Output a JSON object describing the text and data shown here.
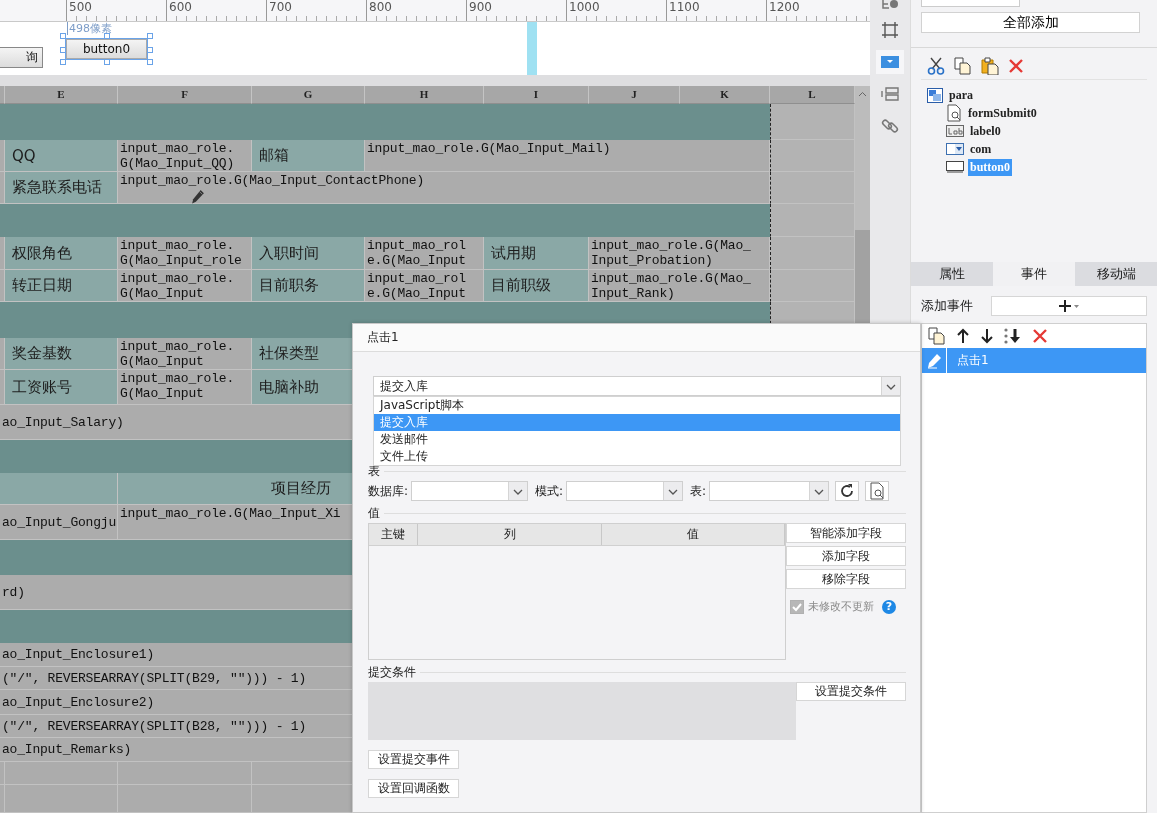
{
  "ruler": {
    "labels": [
      "500",
      "600",
      "700",
      "800",
      "900",
      "1000",
      "1100",
      "1200"
    ]
  },
  "design": {
    "size_hint": "498像素",
    "buttons": [
      {
        "label": "询",
        "selected": false
      },
      {
        "label": "button0",
        "selected": true
      }
    ]
  },
  "sheet": {
    "columns": [
      "E",
      "F",
      "G",
      "H",
      "I",
      "J",
      "K",
      "L"
    ],
    "rows": [
      {
        "kind": "band"
      },
      {
        "kind": "pair",
        "cells": [
          {
            "kind": "edge"
          },
          {
            "kind": "label",
            "text": "QQ"
          },
          {
            "kind": "value",
            "text": "input_mao_role.\nG(Mao_Input_QQ)"
          },
          {
            "kind": "label",
            "text": "邮箱"
          },
          {
            "kind": "value",
            "text": "input_mao_role.G(Mao_Input_Mail)"
          }
        ]
      },
      {
        "kind": "wide",
        "cells": [
          {
            "kind": "edge"
          },
          {
            "kind": "label",
            "text": "紧急联系电话"
          },
          {
            "kind": "value",
            "text": "input_mao_role.G(Mao_Input_ContactPhone)"
          }
        ]
      },
      {
        "kind": "band"
      },
      {
        "kind": "triple",
        "cells": [
          {
            "kind": "edge"
          },
          {
            "kind": "label",
            "text": "权限角色"
          },
          {
            "kind": "value",
            "text": "input_mao_role.\nG(Mao_Input_role"
          },
          {
            "kind": "label",
            "text": "入职时间"
          },
          {
            "kind": "value",
            "text": "input_mao_rol\ne.G(Mao_Input"
          },
          {
            "kind": "label",
            "text": "试用期"
          },
          {
            "kind": "value",
            "text": "input_mao_role.G(Mao_\nInput_Probation)"
          }
        ]
      },
      {
        "kind": "triple",
        "cells": [
          {
            "kind": "edge"
          },
          {
            "kind": "label",
            "text": "转正日期"
          },
          {
            "kind": "value",
            "text": "input_mao_role.\nG(Mao_Input"
          },
          {
            "kind": "label",
            "text": "目前职务"
          },
          {
            "kind": "value",
            "text": "input_mao_rol\ne.G(Mao_Input"
          },
          {
            "kind": "label",
            "text": "目前职级"
          },
          {
            "kind": "value",
            "text": "input_mao_role.G(Mao_\nInput_Rank)"
          }
        ]
      },
      {
        "kind": "band"
      },
      {
        "kind": "pair_cut",
        "cells": [
          {
            "kind": "edge"
          },
          {
            "kind": "label",
            "text": "奖金基数"
          },
          {
            "kind": "value",
            "text": "input_mao_role.\nG(Mao_Input"
          },
          {
            "kind": "label",
            "text": "社保类型"
          }
        ]
      },
      {
        "kind": "pair_cut",
        "cells": [
          {
            "kind": "edge"
          },
          {
            "kind": "label",
            "text": "工资账号"
          },
          {
            "kind": "value",
            "text": "input_mao_role.\nG(Mao_Input"
          },
          {
            "kind": "label",
            "text": "电脑补助"
          }
        ]
      },
      {
        "kind": "full",
        "cells": [
          {
            "kind": "value",
            "text": "ao_Input_Salary)"
          }
        ]
      },
      {
        "kind": "band"
      },
      {
        "kind": "heading",
        "cells": [
          {
            "kind": "label"
          },
          {
            "kind": "caption",
            "text": "项目经历"
          },
          {
            "kind": "label"
          }
        ]
      },
      {
        "kind": "split",
        "cells": [
          {
            "kind": "value",
            "text": "ao_Input_Gongju"
          },
          {
            "kind": "value",
            "text": "input_mao_role.G(Mao_Input_Xi"
          }
        ]
      },
      {
        "kind": "band"
      },
      {
        "kind": "full",
        "cells": [
          {
            "kind": "value",
            "text": "rd)"
          }
        ]
      },
      {
        "kind": "band"
      },
      {
        "kind": "full",
        "cells": [
          {
            "kind": "value",
            "text": "ao_Input_Enclosure1)"
          }
        ]
      },
      {
        "kind": "full",
        "cells": [
          {
            "kind": "value",
            "text": "(\"/\", REVERSEARRAY(SPLIT(B29, \"\"))) - 1)"
          }
        ]
      },
      {
        "kind": "full",
        "cells": [
          {
            "kind": "value",
            "text": "ao_Input_Enclosure2)"
          }
        ]
      },
      {
        "kind": "full",
        "cells": [
          {
            "kind": "value",
            "text": "(\"/\", REVERSEARRAY(SPLIT(B28, \"\"))) - 1)"
          }
        ]
      },
      {
        "kind": "full",
        "cells": [
          {
            "kind": "value",
            "text": "ao_Input_Remarks)"
          }
        ]
      },
      {
        "kind": "blank"
      },
      {
        "kind": "blank"
      }
    ]
  },
  "tool_strip": [
    {
      "kind": "info",
      "selected": false
    },
    {
      "kind": "frame",
      "selected": false
    },
    {
      "kind": "combo",
      "selected": true
    },
    {
      "kind": "list",
      "selected": false
    },
    {
      "kind": "link",
      "selected": false
    }
  ],
  "right_panel": {
    "add_all_button": "全部添加",
    "tree": {
      "label": "para",
      "children": [
        {
          "kind": "submit",
          "label": "formSubmit0",
          "selected": false
        },
        {
          "kind": "label",
          "label": "label0",
          "selected": false
        },
        {
          "kind": "combo",
          "label": "com",
          "selected": false
        },
        {
          "kind": "button",
          "label": "button0",
          "selected": true
        }
      ]
    },
    "tabs": [
      {
        "label": "属性",
        "selected": false
      },
      {
        "label": "事件",
        "selected": true
      },
      {
        "label": "移动端",
        "selected": false
      }
    ],
    "add_event_label": "添加事件",
    "events": [
      {
        "label": "点击1",
        "selected": true
      }
    ]
  },
  "dialog": {
    "title": "点击1",
    "action": {
      "value": "提交入库",
      "options": [
        {
          "label": "JavaScript脚本",
          "selected": false
        },
        {
          "label": "提交入库",
          "selected": true
        },
        {
          "label": "发送邮件",
          "selected": false
        },
        {
          "label": "文件上传",
          "selected": false
        }
      ]
    },
    "table_section": "表",
    "database_label": "数据库:",
    "mode_label": "模式:",
    "table_label": "表:",
    "values_section": "值",
    "columns": [
      "主键",
      "列",
      "值"
    ],
    "buttons": [
      "智能添加字段",
      "添加字段",
      "移除字段"
    ],
    "skip_unchanged": {
      "label": "未修改不更新",
      "checked": true,
      "disabled": true
    },
    "help": "?",
    "condition_section": "提交条件",
    "condition_button": "设置提交条件",
    "bottom_buttons": [
      "设置提交事件",
      "设置回调函数"
    ]
  }
}
